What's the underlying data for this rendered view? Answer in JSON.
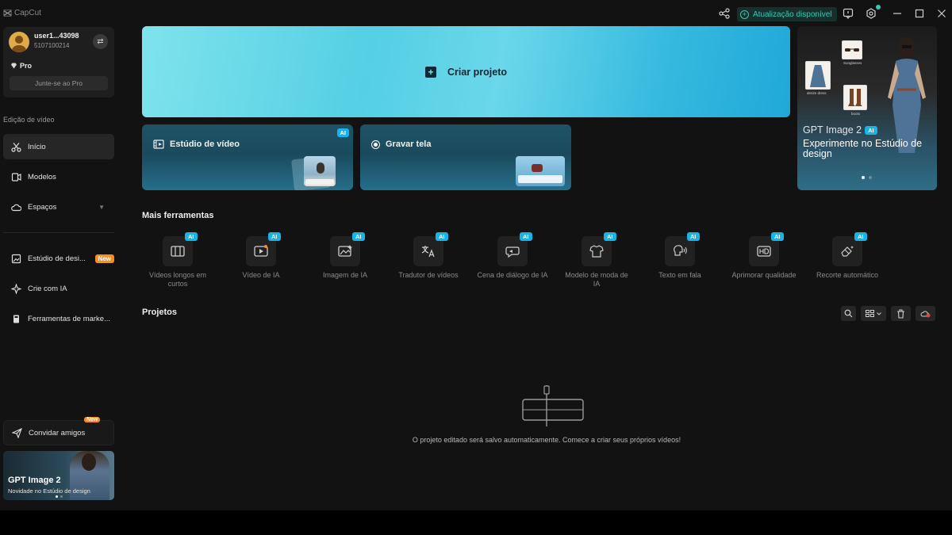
{
  "titlebar": {
    "app_name": "CapCut",
    "update_label": "Atualização disponível"
  },
  "profile": {
    "username": "user1...43098",
    "user_id": "5107100214",
    "plan": "Pro",
    "join_pro": "Junte-se ao Pro"
  },
  "sidebar": {
    "section_title": "Edição de vídeo",
    "items": [
      {
        "label": "Início",
        "icon": "scissors-icon"
      },
      {
        "label": "Modelos",
        "icon": "template-icon"
      },
      {
        "label": "Espaços",
        "icon": "cloud-icon"
      },
      {
        "label": "Estúdio de desi...",
        "icon": "image-edit-icon",
        "badge": "New"
      },
      {
        "label": "Crie com IA",
        "icon": "sparkle-icon"
      },
      {
        "label": "Ferramentas de marke...",
        "icon": "marketing-icon"
      }
    ],
    "invite": {
      "label": "Convidar amigos",
      "tag": "New"
    },
    "promo": {
      "title": "GPT Image 2",
      "subtitle": "Novidade no Estúdio de design"
    }
  },
  "main": {
    "create_project": "Criar projeto",
    "cards": [
      {
        "label": "Estúdio de vídeo",
        "badge": "AI"
      },
      {
        "label": "Gravar tela"
      }
    ],
    "gpt_card": {
      "title": "GPT Image 2",
      "badge": "AI",
      "subtitle": "Experimente no Estúdio de design",
      "chips": [
        "Sunglasses",
        "denim dress",
        "boots"
      ]
    },
    "more_tools_title": "Mais ferramentas",
    "tools": [
      {
        "label": "Vídeos longos em curtos",
        "badge": "AI"
      },
      {
        "label": "Vídeo de IA",
        "badge": "AI"
      },
      {
        "label": "Imagem de IA",
        "badge": "AI"
      },
      {
        "label": "Tradutor de vídeos",
        "badge": "AI"
      },
      {
        "label": "Cena de diálogo de IA",
        "badge": "AI"
      },
      {
        "label": "Modelo de moda de IA",
        "badge": "AI"
      },
      {
        "label": "Texto em fala",
        "badge": "AI"
      },
      {
        "label": "Aprimorar qualidade",
        "badge": "AI"
      },
      {
        "label": "Recorte automático",
        "badge": "AI"
      }
    ],
    "projects_title": "Projetos",
    "empty_text": "O projeto editado será salvo automaticamente. Comece a criar seus próprios vídeos!"
  },
  "colors": {
    "accent_teal": "#33c9b6",
    "ai_badge": "#18b4e8",
    "new_badge": "#ff8a1e",
    "background": "#121212"
  }
}
